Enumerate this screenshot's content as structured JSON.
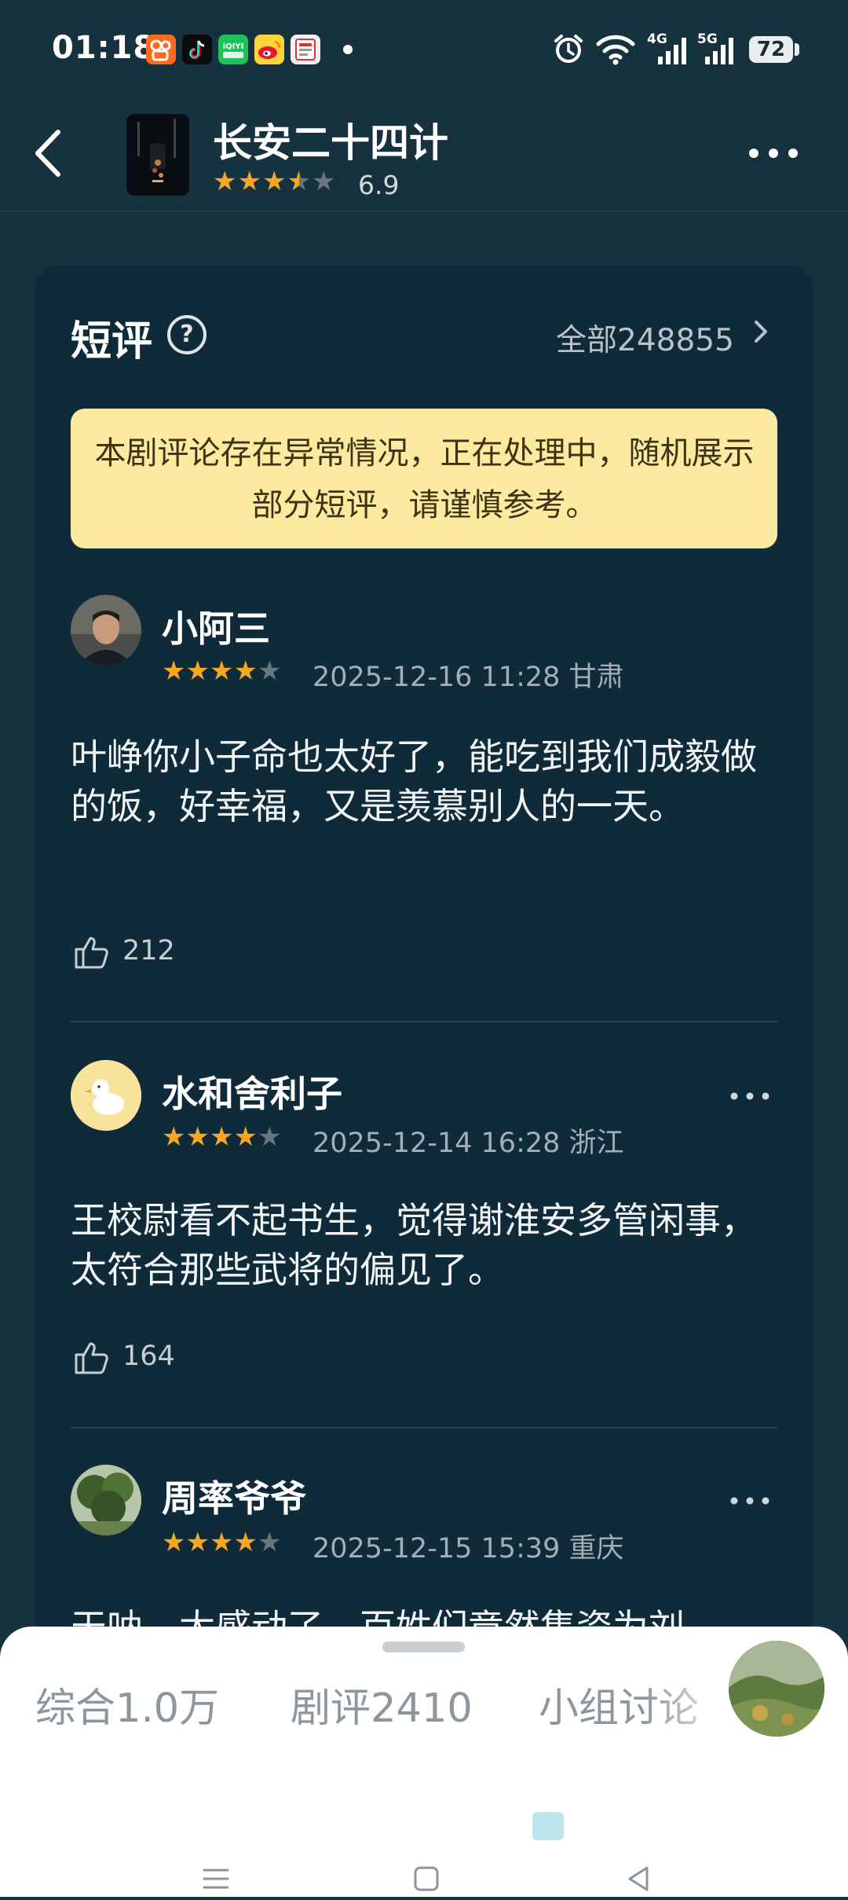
{
  "status_bar": {
    "time": "01:18",
    "app_icons": [
      "kuaishou-icon",
      "douyin-icon",
      "iqiyi-icon",
      "weibo-icon",
      "news-app-icon"
    ],
    "signal_1": "4G",
    "signal_2": "5G",
    "battery": "72"
  },
  "header": {
    "title": "长安二十四计",
    "rating_stars": 3.5,
    "score": "6.9"
  },
  "section": {
    "title": "短评",
    "all_label": "全部248855"
  },
  "notice": "本剧评论存在异常情况，正在处理中，随机展示部分短评，请谨慎参考。",
  "reviews": [
    {
      "username": "小阿三",
      "stars": 4,
      "meta": "2025-12-16 11:28 甘肃",
      "text": "叶峥你小子命也太好了，能吃到我们成毅做的饭，好幸福，又是羡慕别人的一天。",
      "likes": "212"
    },
    {
      "username": "水和舍利子",
      "stars": 4,
      "meta": "2025-12-14 16:28 浙江",
      "text": "王校尉看不起书生，觉得谢淮安多管闲事，太符合那些武将的偏见了。",
      "likes": "164"
    },
    {
      "username": "周率爷爷",
      "stars": 4,
      "meta": "2025-12-15 15:39 重庆",
      "text": "天呐，太感动了，百姓们竟然集资为刘"
    }
  ],
  "bottom_tabs": [
    {
      "label": "综合1.0万"
    },
    {
      "label": "剧评2410"
    },
    {
      "label": "小组讨论"
    }
  ],
  "colors": {
    "background": "#16323f",
    "card": "#0f2a38",
    "star": "#f5a623",
    "notice": "#fbeaa0"
  }
}
